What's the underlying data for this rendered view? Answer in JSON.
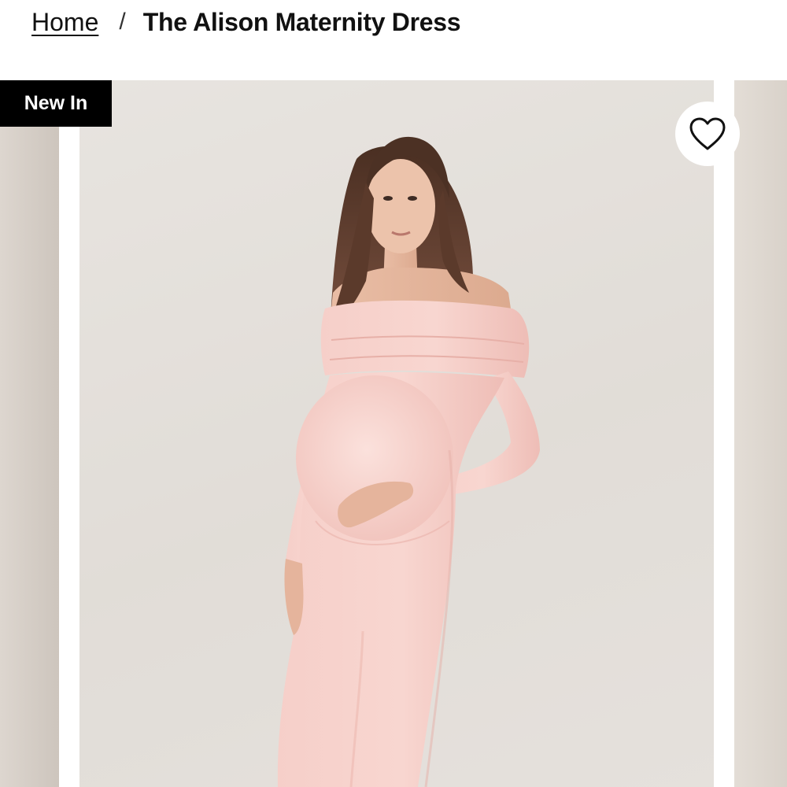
{
  "breadcrumb": {
    "home_label": "Home",
    "separator": "/",
    "current_label": "The Alison Maternity Dress"
  },
  "badge": {
    "label": "New In",
    "background": "#000000",
    "text_color": "#ffffff"
  },
  "wishlist": {
    "icon": "heart-outline-icon"
  },
  "gallery": {
    "main_image_alt": "",
    "dress_color": "#f4c9c4"
  }
}
